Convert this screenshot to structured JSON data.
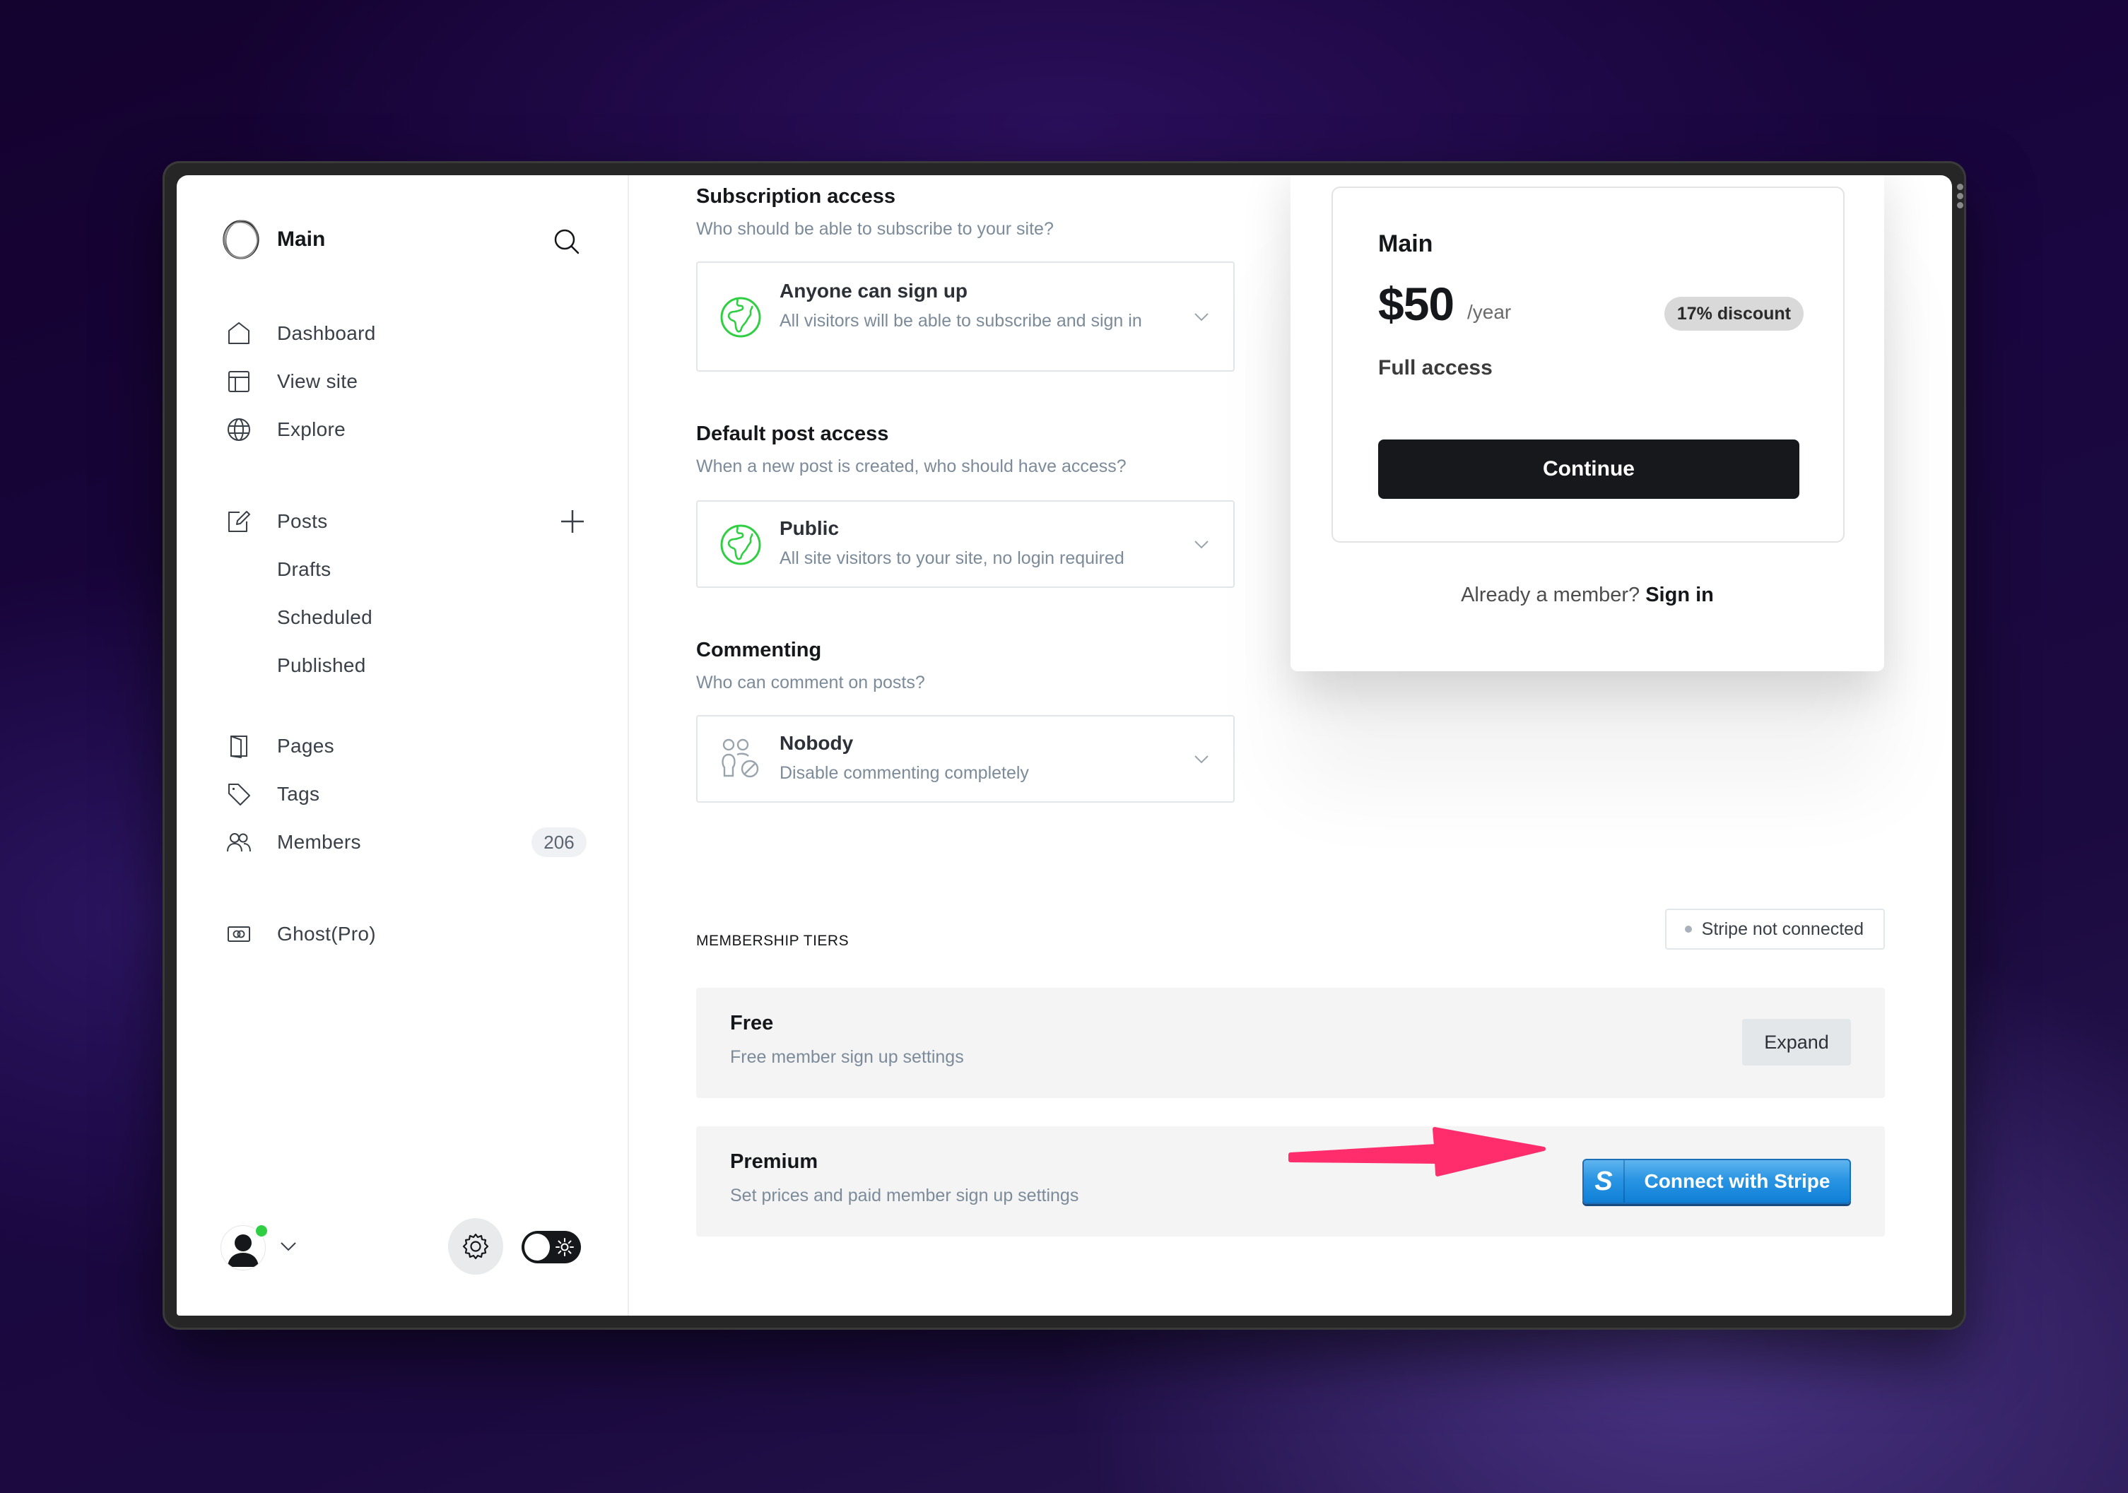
{
  "sidebar": {
    "brand_name": "Main",
    "nav": [
      {
        "label": "Dashboard",
        "icon": "home-icon"
      },
      {
        "label": "View site",
        "icon": "layout-icon"
      },
      {
        "label": "Explore",
        "icon": "globe-icon"
      }
    ],
    "posts": {
      "label": "Posts",
      "icon": "edit-icon",
      "subitems": [
        "Drafts",
        "Scheduled",
        "Published"
      ]
    },
    "content": [
      {
        "label": "Pages",
        "icon": "pages-icon"
      },
      {
        "label": "Tags",
        "icon": "tag-icon"
      },
      {
        "label": "Members",
        "icon": "members-icon",
        "count": "206"
      }
    ],
    "billing": {
      "label": "Ghost(Pro)",
      "icon": "ghost-pro-icon"
    },
    "user_online_color": "#30cf43"
  },
  "settings": {
    "subscription": {
      "title": "Subscription access",
      "description": "Who should be able to subscribe to your site?",
      "selected_title": "Anyone can sign up",
      "selected_description": "All visitors will be able to subscribe and sign in"
    },
    "post_access": {
      "title": "Default post access",
      "description": "When a new post is created, who should have access?",
      "selected_title": "Public",
      "selected_description": "All site visitors to your site, no login required"
    },
    "commenting": {
      "title": "Commenting",
      "description": "Who can comment on posts?",
      "selected_title": "Nobody",
      "selected_description": "Disable commenting completely"
    }
  },
  "preview": {
    "tier_name": "Main",
    "price": "$50",
    "period": "/year",
    "discount": "17% discount",
    "benefit": "Full access",
    "continue_label": "Continue",
    "already_member": "Already a member?",
    "sign_in": "Sign in"
  },
  "tiers": {
    "section_label": "MEMBERSHIP TIERS",
    "stripe_status": "Stripe not connected",
    "items": [
      {
        "title": "Free",
        "description": "Free member sign up settings",
        "action": "Expand"
      },
      {
        "title": "Premium",
        "description": "Set prices and paid member sign up settings",
        "action": "Connect with Stripe"
      }
    ],
    "stripe_logo_letter": "S"
  },
  "colors": {
    "accent_green": "#30cf43",
    "stripe_blue": "#2a95e3",
    "annotation_arrow": "#ff2d6b"
  }
}
